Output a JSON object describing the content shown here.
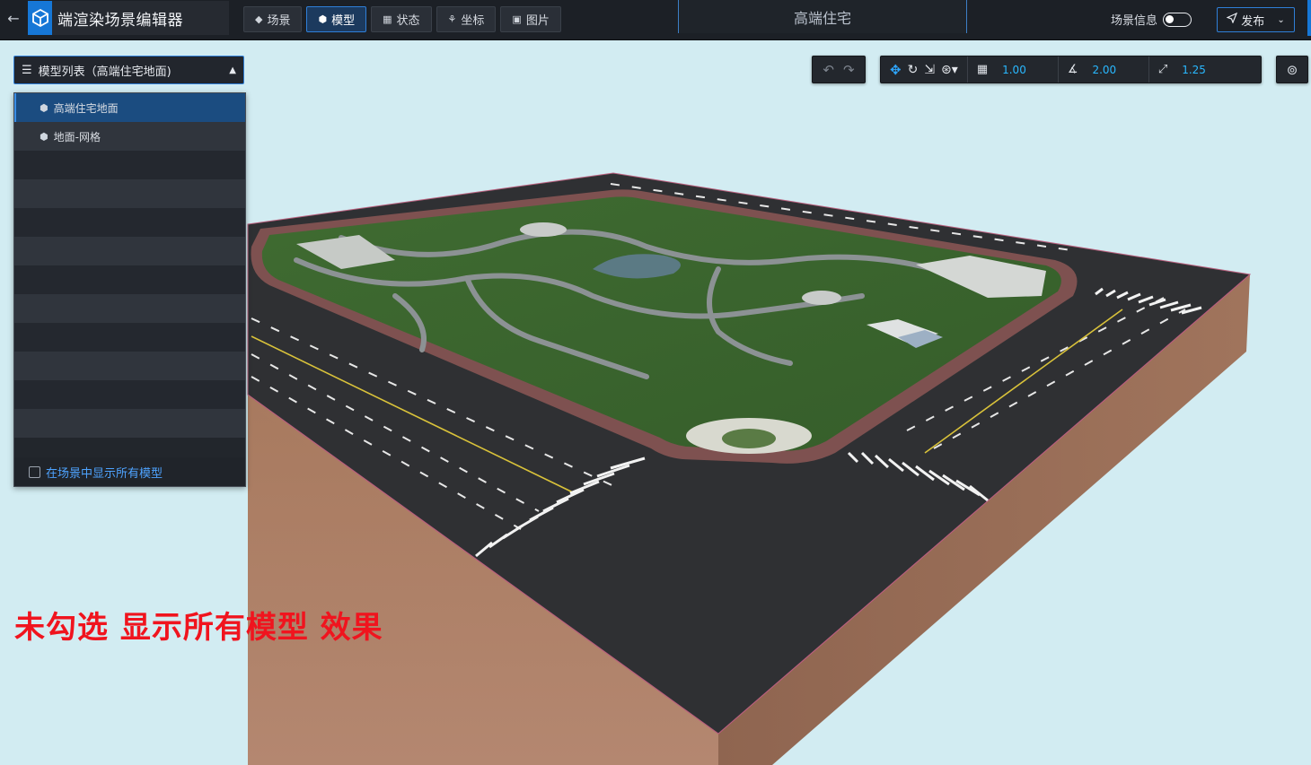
{
  "header": {
    "app_title": "端渲染场景编辑器",
    "scene_title": "高端住宅",
    "scene_info_label": "场景信息",
    "scene_info_enabled": false,
    "publish_label": "发布",
    "nav_tabs": [
      {
        "label": "场景",
        "icon": "layers-icon",
        "active": false
      },
      {
        "label": "模型",
        "icon": "cube-icon",
        "active": true
      },
      {
        "label": "状态",
        "icon": "grid-icon",
        "active": false
      },
      {
        "label": "坐标",
        "icon": "coordinate-icon",
        "active": false
      },
      {
        "label": "图片",
        "icon": "image-icon",
        "active": false
      }
    ]
  },
  "model_panel": {
    "header_label": "模型列表（高端住宅地面)",
    "items": [
      {
        "label": "高端住宅地面",
        "selected": true
      },
      {
        "label": "地面-网格",
        "selected": false
      }
    ],
    "show_all_label": "在场景中显示所有模型",
    "show_all_checked": false
  },
  "toolbar": {
    "grid_snap": "1.00",
    "angle_snap": "2.00",
    "scale_snap": "1.25"
  },
  "caption": "未勾选 显示所有模型 效果",
  "colors": {
    "accent": "#2f7fd8",
    "value_text": "#29b8ff",
    "caption": "#f0141e",
    "viewport_bg": "#d2ecf2"
  }
}
